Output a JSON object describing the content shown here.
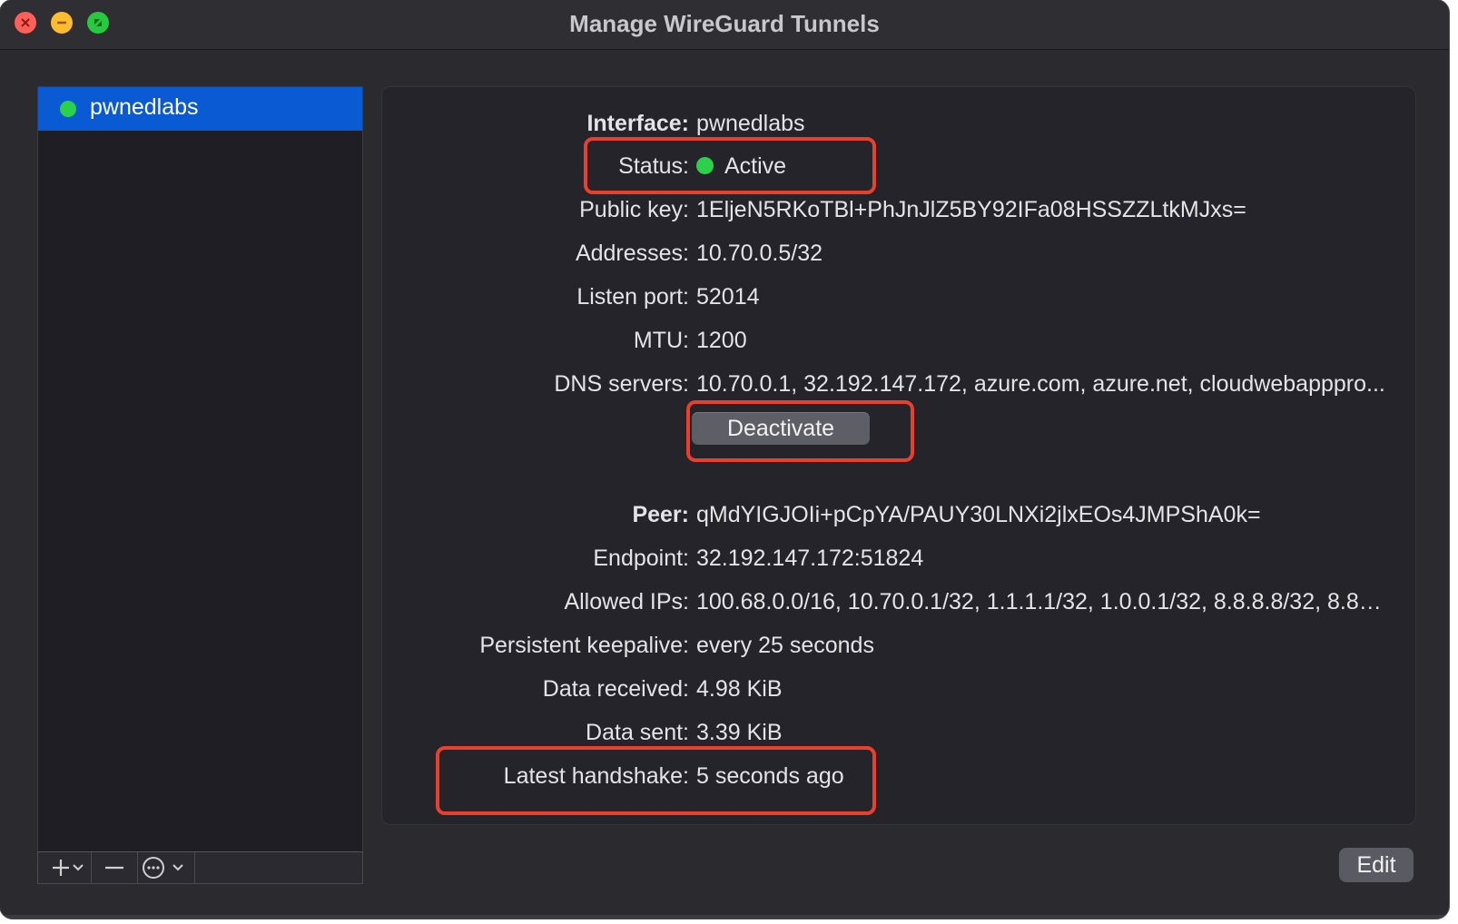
{
  "window": {
    "title": "Manage WireGuard Tunnels"
  },
  "sidebar": {
    "tunnels": [
      {
        "name": "pwnedlabs",
        "status_color": "#2bd14a",
        "selected": true
      }
    ],
    "toolbar": {
      "add_icon": "plus-icon",
      "remove_icon": "minus-icon",
      "more_icon": "ellipsis-circle-icon"
    }
  },
  "interface": {
    "interface_label": "Interface:",
    "interface_value": "pwnedlabs",
    "status_label": "Status:",
    "status_value": "Active",
    "public_key_label": "Public key:",
    "public_key_value": "1EljeN5RKoTBl+PhJnJlZ5BY92IFa08HSSZZLtkMJxs=",
    "addresses_label": "Addresses:",
    "addresses_value": "10.70.0.5/32",
    "listen_port_label": "Listen port:",
    "listen_port_value": "52014",
    "mtu_label": "MTU:",
    "mtu_value": "1200",
    "dns_label": "DNS servers:",
    "dns_value": "10.70.0.1, 32.192.147.172, azure.com, azure.net, cloudwebapppro...",
    "deactivate_label": "Deactivate"
  },
  "peer": {
    "peer_label": "Peer:",
    "peer_value": "qMdYIGJOIi+pCpYA/PAUY30LNXi2jlxEOs4JMPShA0k=",
    "endpoint_label": "Endpoint:",
    "endpoint_value": "32.192.147.172:51824",
    "allowed_ips_label": "Allowed IPs:",
    "allowed_ips_value": "100.68.0.0/16, 10.70.0.1/32, 1.1.1.1/32, 1.0.0.1/32, 8.8.8.8/32, 8.8.4....",
    "keepalive_label": "Persistent keepalive:",
    "keepalive_value": "every 25 seconds",
    "received_label": "Data received:",
    "received_value": "4.98 KiB",
    "sent_label": "Data sent:",
    "sent_value": "3.39 KiB",
    "handshake_label": "Latest handshake:",
    "handshake_value": "5 seconds ago"
  },
  "footer": {
    "edit_label": "Edit"
  },
  "colors": {
    "accent": "#0a5ad4",
    "active": "#2bd14a",
    "highlight": "#e8402e"
  }
}
